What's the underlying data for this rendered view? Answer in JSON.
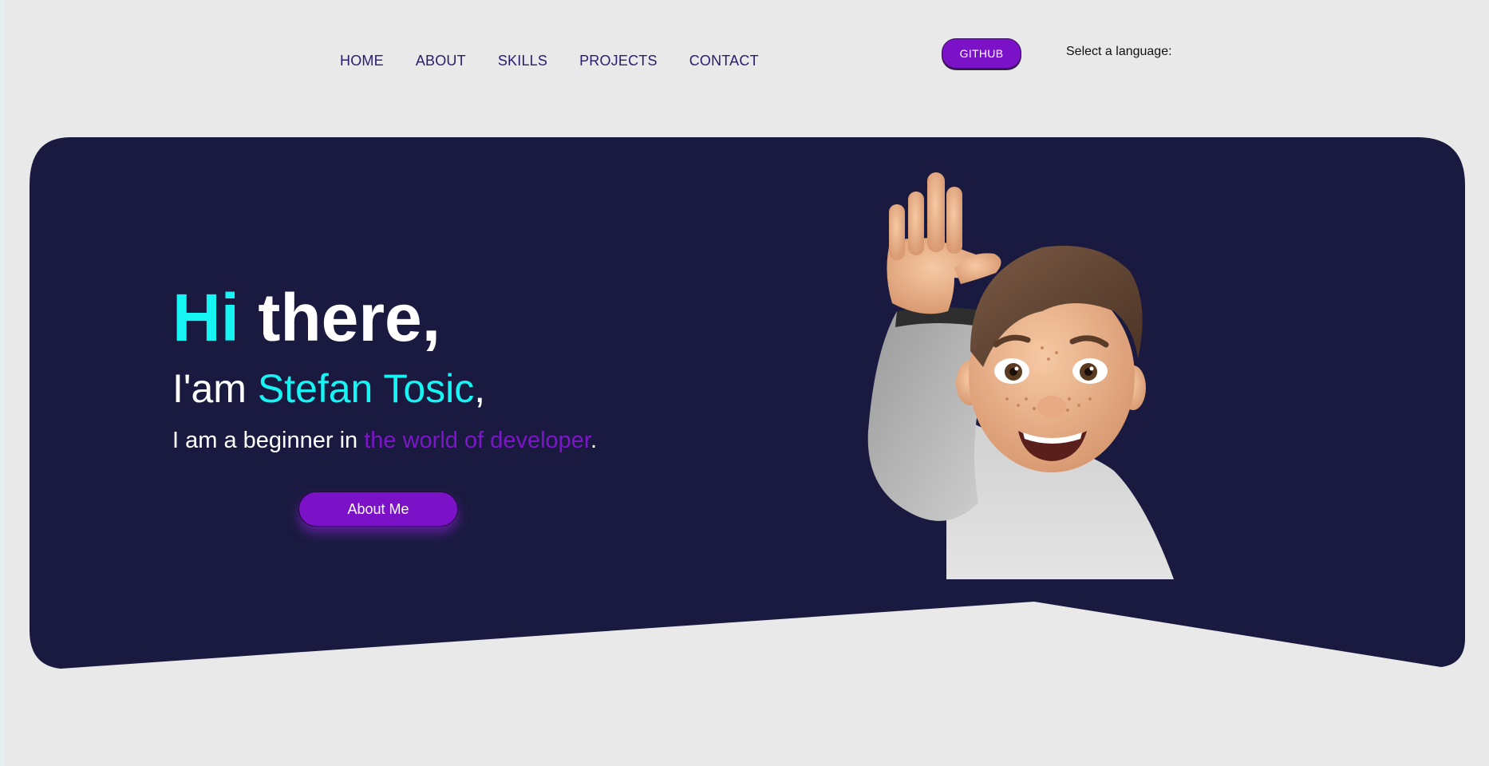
{
  "nav": {
    "items": [
      {
        "label": "HOME"
      },
      {
        "label": "ABOUT"
      },
      {
        "label": "SKILLS"
      },
      {
        "label": "PROJECTS"
      },
      {
        "label": "CONTACT"
      }
    ]
  },
  "header": {
    "github_label": "GITHUB",
    "language_label": "Select a language:"
  },
  "hero": {
    "greeting_hi": "Hi",
    "greeting_there": "there",
    "greeting_comma": ",",
    "intro_prefix": "I'am",
    "name": "Stefan Tosic",
    "name_suffix": ",",
    "tagline_prefix": "I am a beginner in",
    "tagline_highlight": "the world of developer",
    "tagline_suffix": ".",
    "cta_label": "About Me"
  },
  "colors": {
    "hero_background": "#1a1a40",
    "accent_cyan": "#16f4f4",
    "accent_purple": "#7b12c8",
    "nav_text": "#2b1b6e",
    "page_background": "#e9e9e9"
  },
  "icons": {
    "avatar": "waving-memoji-avatar"
  }
}
